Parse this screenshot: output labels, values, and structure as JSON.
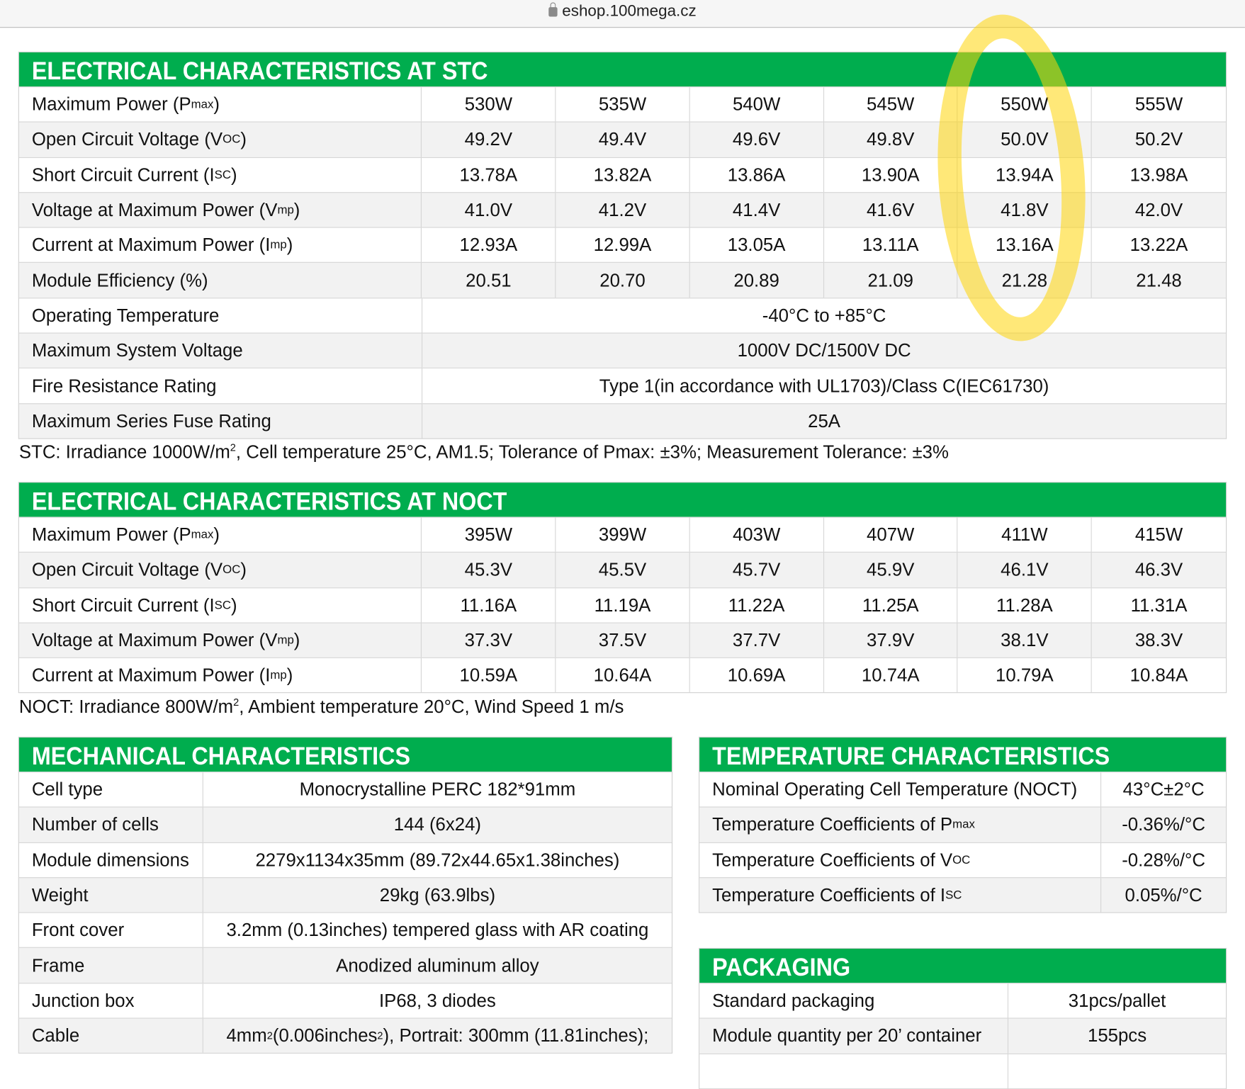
{
  "browser": {
    "url": "eshop.100mega.cz"
  },
  "stc": {
    "title": "ELECTRICAL CHARACTERISTICS AT STC",
    "rows": [
      {
        "label": [
          "Maximum Power (P",
          "max",
          ")"
        ],
        "values": [
          "530W",
          "535W",
          "540W",
          "545W",
          "550W",
          "555W"
        ]
      },
      {
        "label": [
          "Open Circuit Voltage (V",
          "OC",
          ")"
        ],
        "values": [
          "49.2V",
          "49.4V",
          "49.6V",
          "49.8V",
          "50.0V",
          "50.2V"
        ]
      },
      {
        "label": [
          "Short Circuit Current (I",
          "SC",
          ")"
        ],
        "values": [
          "13.78A",
          "13.82A",
          "13.86A",
          "13.90A",
          "13.94A",
          "13.98A"
        ]
      },
      {
        "label": [
          "Voltage at Maximum Power (V",
          "mp",
          ")"
        ],
        "values": [
          "41.0V",
          "41.2V",
          "41.4V",
          "41.6V",
          "41.8V",
          "42.0V"
        ]
      },
      {
        "label": [
          "Current at Maximum Power (I",
          "mp",
          ")"
        ],
        "values": [
          "12.93A",
          "12.99A",
          "13.05A",
          "13.11A",
          "13.16A",
          "13.22A"
        ]
      },
      {
        "label": [
          "Module Efficiency (%)"
        ],
        "values": [
          "20.51",
          "20.70",
          "20.89",
          "21.09",
          "21.28",
          "21.48"
        ]
      },
      {
        "label": [
          "Operating Temperature"
        ],
        "span": "-40°C to +85°C"
      },
      {
        "label": [
          "Maximum System Voltage"
        ],
        "span": "1000V DC/1500V DC"
      },
      {
        "label": [
          "Fire Resistance Rating"
        ],
        "span": "Type 1(in accordance with UL1703)/Class C(IEC61730)"
      },
      {
        "label": [
          "Maximum Series Fuse Rating"
        ],
        "span": "25A"
      }
    ],
    "note": [
      "STC: Irradiance 1000W/m",
      "2",
      ", Cell temperature 25°C, AM1.5; Tolerance of Pmax: ±3%; Measurement Tolerance: ±3%"
    ]
  },
  "noct": {
    "title": "ELECTRICAL CHARACTERISTICS AT NOCT",
    "rows": [
      {
        "label": [
          "Maximum Power (P",
          "max",
          ")"
        ],
        "values": [
          "395W",
          "399W",
          "403W",
          "407W",
          "411W",
          "415W"
        ]
      },
      {
        "label": [
          "Open Circuit Voltage (V",
          "OC",
          ")"
        ],
        "values": [
          "45.3V",
          "45.5V",
          "45.7V",
          "45.9V",
          "46.1V",
          "46.3V"
        ]
      },
      {
        "label": [
          "Short Circuit Current (I",
          "SC",
          ")"
        ],
        "values": [
          "11.16A",
          "11.19A",
          "11.22A",
          "11.25A",
          "11.28A",
          "11.31A"
        ]
      },
      {
        "label": [
          "Voltage at Maximum Power (V",
          "mp",
          ")"
        ],
        "values": [
          "37.3V",
          "37.5V",
          "37.7V",
          "37.9V",
          "38.1V",
          "38.3V"
        ]
      },
      {
        "label": [
          "Current at Maximum Power (I",
          "mp",
          ")"
        ],
        "values": [
          "10.59A",
          "10.64A",
          "10.69A",
          "10.74A",
          "10.79A",
          "10.84A"
        ]
      }
    ],
    "note": [
      "NOCT: Irradiance 800W/m",
      "2",
      ", Ambient temperature 20°C, Wind Speed 1 m/s"
    ]
  },
  "mechanical": {
    "title": "MECHANICAL CHARACTERISTICS",
    "rows": [
      {
        "label": [
          "Cell type"
        ],
        "value": [
          "Monocrystalline PERC 182*91mm"
        ]
      },
      {
        "label": [
          "Number of cells"
        ],
        "value": [
          "144 (6x24)"
        ]
      },
      {
        "label": [
          "Module dimensions"
        ],
        "value": [
          "2279x1134x35mm (89.72x44.65x1.38inches)"
        ]
      },
      {
        "label": [
          "Weight"
        ],
        "value": [
          "29kg (63.9lbs)"
        ]
      },
      {
        "label": [
          "Front cover"
        ],
        "value": [
          "3.2mm (0.13inches) tempered glass with AR coating"
        ]
      },
      {
        "label": [
          "Frame"
        ],
        "value": [
          "Anodized aluminum alloy"
        ]
      },
      {
        "label": [
          "Junction box"
        ],
        "value": [
          "IP68, 3 diodes"
        ]
      },
      {
        "label": [
          "Cable"
        ],
        "value": [
          "4mm",
          "2",
          " (0.006inches",
          "2",
          "), Portrait: 300mm (11.81inches);"
        ]
      }
    ]
  },
  "temperature": {
    "title": "TEMPERATURE CHARACTERISTICS",
    "rows": [
      {
        "label": [
          "Nominal Operating Cell Temperature (NOCT)"
        ],
        "value": "43°C±2°C"
      },
      {
        "label": [
          "Temperature Coefficients of P",
          "max",
          ""
        ],
        "value": "-0.36%/°C"
      },
      {
        "label": [
          "Temperature Coefficients of V",
          "OC",
          ""
        ],
        "value": "-0.28%/°C"
      },
      {
        "label": [
          "Temperature Coefficients of I",
          "SC",
          ""
        ],
        "value": "0.05%/°C"
      }
    ]
  },
  "packaging": {
    "title": "PACKAGING",
    "rows": [
      {
        "label": [
          "Standard packaging"
        ],
        "value": "31pcs/pallet"
      },
      {
        "label": [
          "Module quantity per 20’ container"
        ],
        "value": "155pcs"
      },
      {
        "label": [
          ""
        ],
        "value": ""
      }
    ]
  },
  "colors": {
    "header_green": "#00ad4e",
    "highlight": "#ffd60a"
  }
}
